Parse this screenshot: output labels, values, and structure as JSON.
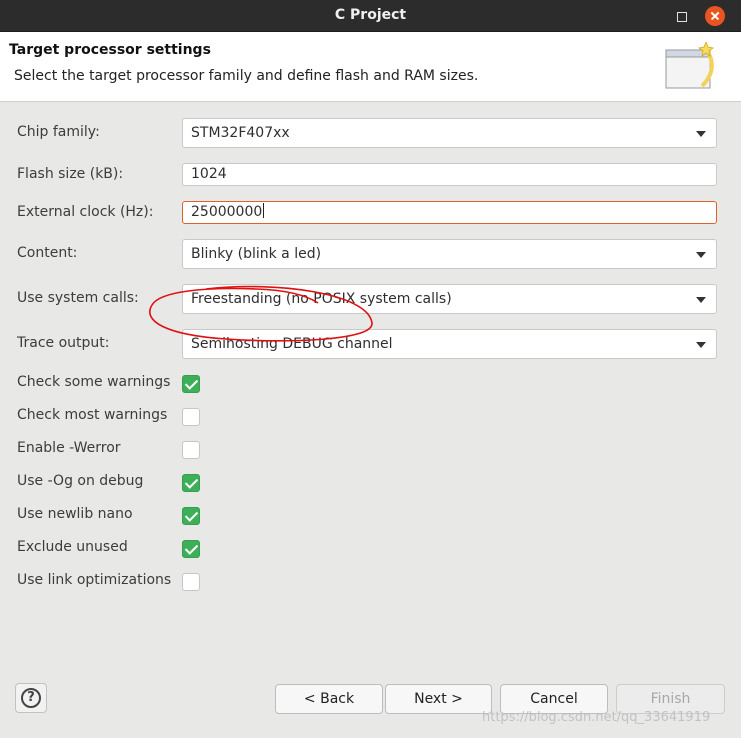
{
  "window": {
    "title": "C Project"
  },
  "header": {
    "title": "Target processor settings",
    "description": "Select the target processor family and define flash and RAM sizes."
  },
  "form": {
    "chip_family": {
      "label": "Chip family:",
      "value": "STM32F407xx"
    },
    "flash_size": {
      "label": "Flash size (kB):",
      "value": "1024"
    },
    "external_clock": {
      "label": "External clock (Hz):",
      "value": "25000000"
    },
    "content": {
      "label": "Content:",
      "value": "Blinky (blink a led)"
    },
    "system_calls": {
      "label": "Use system calls:",
      "value": "Freestanding (no POSIX system calls)"
    },
    "trace_output": {
      "label": "Trace output:",
      "value": "Semihosting DEBUG channel"
    },
    "checkboxes": [
      {
        "label": "Check some warnings",
        "checked": true
      },
      {
        "label": "Check most warnings",
        "checked": false
      },
      {
        "label": "Enable -Werror",
        "checked": false
      },
      {
        "label": "Use -Og on debug",
        "checked": true
      },
      {
        "label": "Use newlib nano",
        "checked": true
      },
      {
        "label": "Exclude unused",
        "checked": true
      },
      {
        "label": "Use link optimizations",
        "checked": false
      }
    ]
  },
  "footer": {
    "back_label": "< Back",
    "next_label": "Next >",
    "cancel_label": "Cancel",
    "finish_label": "Finish",
    "watermark": "https://blog.csdn.net/qq_33641919"
  },
  "colors": {
    "accent": "#e95420",
    "check_green": "#3daf58",
    "annotation_red": "#e01010"
  }
}
